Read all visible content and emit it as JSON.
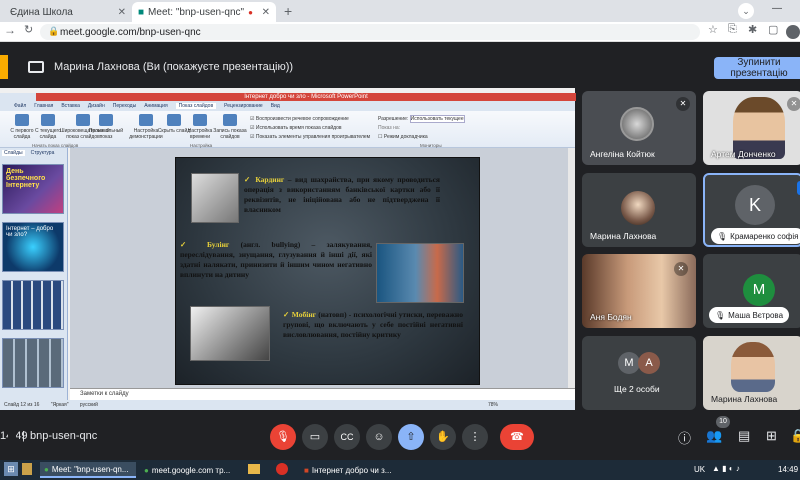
{
  "browser": {
    "tabs": [
      {
        "label": "Єдина Школа",
        "active": false
      },
      {
        "label": "Meet: \"bnp-usen-qnc\"",
        "active": true
      }
    ],
    "url": "meet.google.com/bnp-usen-qnc"
  },
  "meet": {
    "presenting_text": "Марина Лахнова (Ви (покажуєте презентацію))",
    "stop_button": "Зупинити презентацію",
    "meeting_time": "14:49",
    "meeting_code": "bnp-usen-qnc",
    "participant_count": "10",
    "participants": [
      {
        "name": "Ангеліна Койтюк",
        "muted": true
      },
      {
        "name": "Артем Донченко",
        "muted": true
      },
      {
        "name": "Марина Лахнова",
        "muted": false
      },
      {
        "name": "Крамаренко софія",
        "initial": "K",
        "muted": true,
        "color": "#5f6368"
      },
      {
        "name": "Аня Бодян",
        "muted": true
      },
      {
        "name": "Маша Вєтрова",
        "initial": "М",
        "muted": true,
        "color": "#1e8e3e"
      },
      {
        "name": "Ще 2 особи",
        "initials": [
          "М",
          "А"
        ]
      },
      {
        "name": "Марина Лахнова",
        "muted": false
      }
    ]
  },
  "ppt": {
    "title": "Інтернет добро чи зло - Microsoft PowerPoint",
    "ribbon_tabs": [
      "Файл",
      "Главная",
      "Вставка",
      "Дизайн",
      "Переходы",
      "Анимация",
      "Показ слайдов",
      "Рецензирование",
      "Вид"
    ],
    "active_tab": "Показ слайдов",
    "ribbon_buttons": [
      "С первого слайда",
      "С текущего слайда",
      "Широковещательный показ слайдов",
      "Произвольный показ",
      "Настройка демонстрации",
      "Скрыть слайд",
      "Настройка времени",
      "Запись показа слайдов"
    ],
    "checkboxes": [
      "Воспроизвести речевое сопровождение",
      "Использовать время показа слайдов",
      "Показать элементы управления проигрывателем"
    ],
    "monitor": {
      "resolution_label": "Разрешение:",
      "resolution_value": "Использовать текущее",
      "show_on": "Показ на:",
      "presenter_view": "Режим докладчика"
    },
    "group_labels": [
      "Начать показ слайдов",
      "Настройка",
      "Мониторы"
    ],
    "panel_tabs": [
      "Слайды",
      "Структура"
    ],
    "thumbs": [
      {
        "text": "День безпечного Інтернету",
        "color": "#3a2a6a"
      },
      {
        "text": "Інтернет – добро чи зло?",
        "color": "#0d3a6a"
      },
      {
        "text": "",
        "color": "#355a8a"
      },
      {
        "text": "",
        "color": "#4a5a6a"
      }
    ],
    "slide": {
      "p1_term": "Кардинг",
      "p1_text": " – вид шахрайства, при якому проводиться операція з використанням банківської картки або її реквізитів, не ініційована або не підтверджена її власником",
      "p2_term": "Булінг",
      "p2_text": " (англ. bullying) – залякування, переслідування, знущання, глузування й інші дії, які здатні налякати, принизити й іншим чином негативно вплинути на дитину",
      "p3_term": "Мобінг",
      "p3_text": " (натовп) - психологічні утиски, переважно групові, що включають у себе постійні негативні висловлювання, постійну критику"
    },
    "notes_placeholder": "Заметки к слайду",
    "status": {
      "slide_counter": "Слайд 12 из 16",
      "theme": "\"Яркая\"",
      "language": "русский",
      "zoom": "78%"
    }
  },
  "taskbar": {
    "items": [
      {
        "label": "Meet: \"bnp-usen-qn...",
        "active": true
      },
      {
        "label": "meet.google.com тр...",
        "active": false
      },
      {
        "label": "",
        "active": false
      },
      {
        "label": "",
        "active": false
      },
      {
        "label": "Інтернет добро чи з...",
        "active": false
      }
    ],
    "lang": "UK",
    "clock": "14:49"
  },
  "colors": {
    "meet_bg": "#202124",
    "accent": "#8ab4f8",
    "end_call": "#ea4335",
    "present_highlight": "#f9ab00"
  }
}
